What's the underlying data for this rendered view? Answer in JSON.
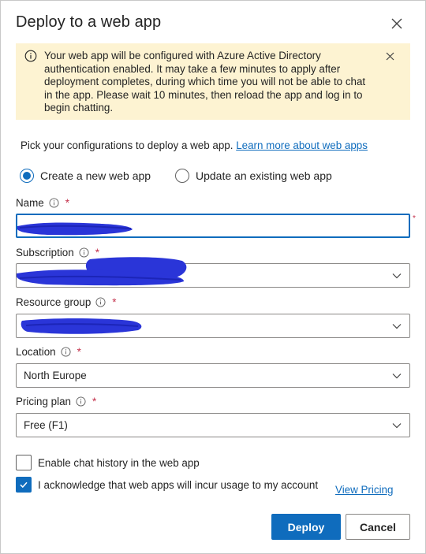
{
  "dialog": {
    "title": "Deploy to a web app"
  },
  "banner": {
    "message": "Your web app will be configured with Azure Active Directory authentication enabled. It may take a few minutes to apply after deployment completes, during which time you will not be able to chat in the app. Please wait 10 minutes, then reload the app and log in to begin chatting.",
    "icon": "info-icon",
    "background_color": "#fdf3d2"
  },
  "intro": {
    "text": "Pick your configurations to deploy a web app.",
    "link_text": "Learn more about web apps"
  },
  "mode": {
    "options": [
      {
        "label": "Create a new web app",
        "selected": true
      },
      {
        "label": "Update an existing web app",
        "selected": false
      }
    ]
  },
  "fields": {
    "name": {
      "label": "Name",
      "required_mark": "*",
      "value": ""
    },
    "subscription": {
      "label": "Subscription",
      "required_mark": "*",
      "value": ""
    },
    "resource_group": {
      "label": "Resource group",
      "required_mark": "*",
      "value": ""
    },
    "location": {
      "label": "Location",
      "required_mark": "*",
      "value": "North Europe"
    },
    "pricing_plan": {
      "label": "Pricing plan",
      "required_mark": "*",
      "value": "Free (F1)"
    }
  },
  "side_required_mark": "*",
  "options": {
    "chat_history": {
      "label": "Enable chat history in the web app",
      "checked": false
    },
    "acknowledge": {
      "label": "I acknowledge that web apps will incur usage to my account",
      "checked": true
    },
    "view_pricing_link": "View Pricing"
  },
  "actions": {
    "deploy_label": "Deploy",
    "cancel_label": "Cancel"
  },
  "colors": {
    "accent": "#0f6cbd",
    "required": "#c4314b",
    "redaction": "#2a35d8"
  }
}
